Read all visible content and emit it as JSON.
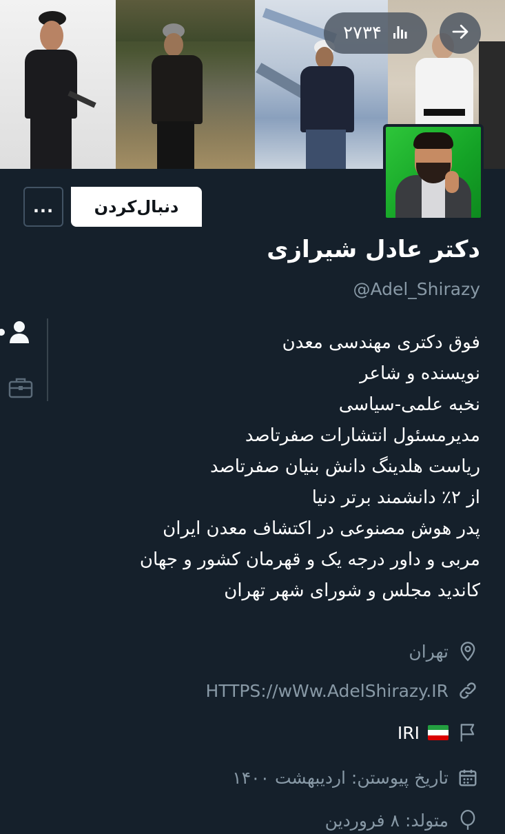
{
  "header": {
    "view_count": "۲۷۳۴",
    "stats_icon": "bar-chart-icon",
    "next_icon": "arrow-right-icon"
  },
  "actions": {
    "follow_label": "دنبال‌کردن",
    "more_label": "..."
  },
  "profile": {
    "display_name": "دکتر عادل شیرازی",
    "handle": "@Adel_Shirazy",
    "bio_lines": [
      "فوق دکتری مهندسی معدن",
      "نویسنده و شاعر",
      "نخبه علمی-سیاسی",
      "مدیرمسئول انتشارات صفرتاصد",
      "ریاست هلدینگ دانش بنیان صفرتاصد",
      "از ۲٪ دانشمند برتر دنیا",
      "پدر هوش مصنوعی در اکتشاف معدن ایران",
      "مربی و داور درجه یک و قهرمان کشور و جهان",
      "کاندید مجلس و شورای شهر تهران"
    ]
  },
  "meta": {
    "location": "تهران",
    "website": "HTTPS://wWw.AdelShirazy.IR",
    "country": "IRI",
    "joined": "تاریخ پیوستن: اردیبهشت ۱۴۰۰",
    "born": "متولد: ۸ فروردین"
  },
  "colors": {
    "background": "#15202b",
    "secondary_text": "#8899a6",
    "border": "#38444d"
  }
}
